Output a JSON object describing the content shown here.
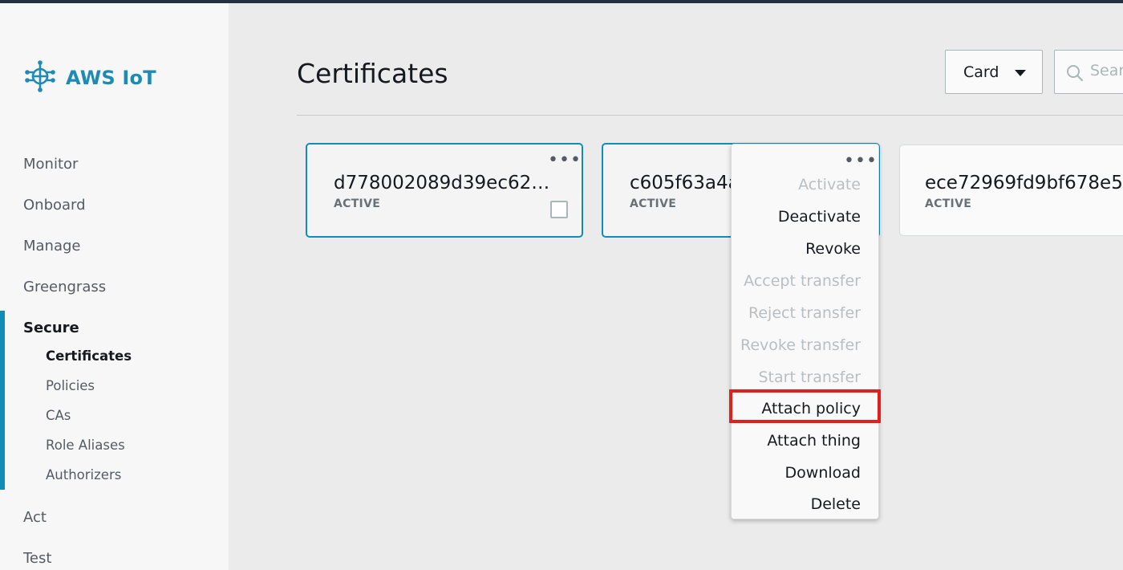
{
  "app": {
    "brand": "AWS IoT",
    "logo_icon": "iot-chip-icon"
  },
  "sidebar": {
    "items": [
      {
        "label": "Monitor",
        "active": false
      },
      {
        "label": "Onboard",
        "active": false
      },
      {
        "label": "Manage",
        "active": false
      },
      {
        "label": "Greengrass",
        "active": false
      },
      {
        "label": "Secure",
        "active": true
      },
      {
        "label": "Act",
        "active": false
      },
      {
        "label": "Test",
        "active": false
      }
    ],
    "secure_sub": [
      {
        "label": "Certificates",
        "active": true
      },
      {
        "label": "Policies",
        "active": false
      },
      {
        "label": "CAs",
        "active": false
      },
      {
        "label": "Role Aliases",
        "active": false
      },
      {
        "label": "Authorizers",
        "active": false
      }
    ]
  },
  "page": {
    "title": "Certificates"
  },
  "toolbar": {
    "view_label": "Card",
    "search_placeholder": "Search",
    "search_icon": "search-icon"
  },
  "cards": [
    {
      "name": "d778002089d39ec62…",
      "status": "ACTIVE"
    },
    {
      "name": "c605f63a4a",
      "status": "ACTIVE"
    },
    {
      "name": "ece72969fd9bf678e5",
      "status": "ACTIVE"
    }
  ],
  "menu": {
    "dots": "•••",
    "items": [
      {
        "label": "Activate",
        "disabled": true
      },
      {
        "label": "Deactivate",
        "disabled": false
      },
      {
        "label": "Revoke",
        "disabled": false
      },
      {
        "label": "Accept transfer",
        "disabled": true
      },
      {
        "label": "Reject transfer",
        "disabled": true
      },
      {
        "label": "Revoke transfer",
        "disabled": true
      },
      {
        "label": "Start transfer",
        "disabled": true
      },
      {
        "label": "Attach policy",
        "disabled": false,
        "highlighted": true
      },
      {
        "label": "Attach thing",
        "disabled": false
      },
      {
        "label": "Download",
        "disabled": false
      },
      {
        "label": "Delete",
        "disabled": false
      }
    ]
  },
  "colors": {
    "accent": "#0f8db7",
    "brand": "#1f8bb4",
    "highlight": "#e0201b"
  }
}
